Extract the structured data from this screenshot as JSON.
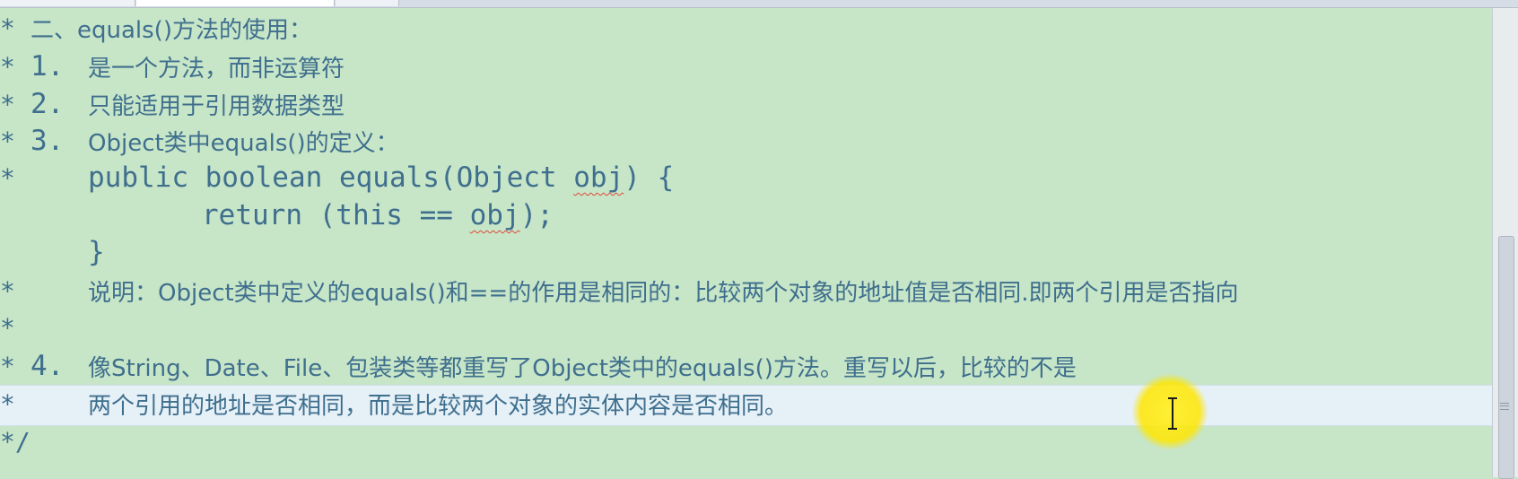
{
  "editor": {
    "gutter_marker": "*",
    "lines": [
      {
        "id": "l0",
        "text": "二、equals()方法的使用："
      },
      {
        "id": "l1",
        "num": "1.",
        "text": "是一个方法，而非运算符"
      },
      {
        "id": "l2",
        "num": "2.",
        "text": "只能适用于引用数据类型"
      },
      {
        "id": "l3",
        "num": "3.",
        "text": "Object类中equals()的定义："
      },
      {
        "id": "l4",
        "code_prefix": "public boolean equals(Object ",
        "code_var": "obj",
        "code_suffix": ") {"
      },
      {
        "id": "l5",
        "code_prefix": "return (this == ",
        "code_var": "obj",
        "code_suffix": ");"
      },
      {
        "id": "l6",
        "code": "}"
      },
      {
        "id": "l7",
        "text": "说明：Object类中定义的equals()和==的作用是相同的：比较两个对象的地址值是否相同.即两个引用是否指向"
      },
      {
        "id": "l8",
        "text": ""
      },
      {
        "id": "l9",
        "num": "4.",
        "text": "像String、Date、File、包装类等都重写了Object类中的equals()方法。重写以后，比较的不是"
      },
      {
        "id": "l10",
        "text": "两个引用的地址是否相同，而是比较两个对象的实体内容是否相同。"
      },
      {
        "id": "l11",
        "text": "*/"
      }
    ]
  },
  "colors": {
    "background": "#c7e5c7",
    "comment_text": "#3f6f8e",
    "current_line": "#e6f0f7",
    "squiggle": "#e0483c",
    "cursor_highlight": "#ffe600"
  },
  "icons": {
    "cursor": "ibeam-cursor-icon",
    "highlight": "cursor-highlight-circle"
  }
}
